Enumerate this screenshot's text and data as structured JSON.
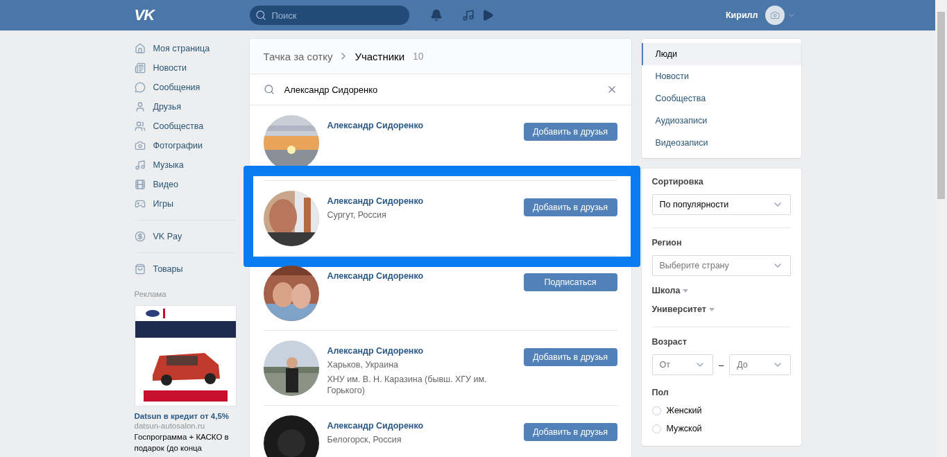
{
  "header": {
    "logo": "VK",
    "search_placeholder": "Поиск",
    "user_name": "Кирилл"
  },
  "nav": [
    {
      "items": [
        {
          "label": "Моя страница"
        },
        {
          "label": "Новости"
        },
        {
          "label": "Сообщения"
        },
        {
          "label": "Друзья"
        },
        {
          "label": "Сообщества"
        },
        {
          "label": "Фотографии"
        },
        {
          "label": "Музыка"
        },
        {
          "label": "Видео"
        },
        {
          "label": "Игры"
        }
      ]
    },
    {
      "items": [
        {
          "label": "VK Pay"
        }
      ]
    },
    {
      "items": [
        {
          "label": "Товары"
        }
      ]
    }
  ],
  "ad": {
    "label": "Реклама",
    "title": "Datsun в кредит от 4,5%",
    "domain": "datsun-autosalon.ru",
    "text": "Госпрограмма + КАСКО в подарок (до конца"
  },
  "breadcrumb": {
    "parent": "Тачка за сотку",
    "current": "Участники",
    "count": "10"
  },
  "search": {
    "value": "Александр Сидоренко"
  },
  "results": [
    {
      "name": "Александр Сидоренко",
      "button": "Добавить в друзья",
      "highlighted": false
    },
    {
      "name": "Александр Сидоренко",
      "lines": [
        "Сургут, Россия"
      ],
      "button": "Добавить в друзья",
      "highlighted": true
    },
    {
      "name": "Александр Сидоренко",
      "button": "Подписаться",
      "highlighted": false
    },
    {
      "name": "Александр Сидоренко",
      "lines": [
        "Харьков, Украина",
        "ХНУ им. В. Н. Каразина (бывш. ХГУ им. Горького)"
      ],
      "button": "Добавить в друзья",
      "highlighted": false
    },
    {
      "name": "Александр Сидоренко",
      "lines": [
        "Белогорск, Россия"
      ],
      "button": "Добавить в друзья",
      "highlighted": false
    }
  ],
  "side_menu": [
    {
      "label": "Люди",
      "selected": true
    },
    {
      "label": "Новости",
      "selected": false
    },
    {
      "label": "Сообщества",
      "selected": false
    },
    {
      "label": "Аудиозаписи",
      "selected": false
    },
    {
      "label": "Видеозаписи",
      "selected": false
    }
  ],
  "filters": {
    "sort": {
      "label": "Сортировка",
      "value": "По популярности"
    },
    "region": {
      "label": "Регион",
      "placeholder": "Выберите страну"
    },
    "school": {
      "label": "Школа"
    },
    "university": {
      "label": "Университет"
    },
    "age": {
      "label": "Возраст",
      "from": "От",
      "dash": "–",
      "to": "До"
    },
    "gender": {
      "label": "Пол",
      "options": [
        {
          "label": "Женский",
          "selected": false
        },
        {
          "label": "Мужской",
          "selected": false
        }
      ]
    }
  }
}
